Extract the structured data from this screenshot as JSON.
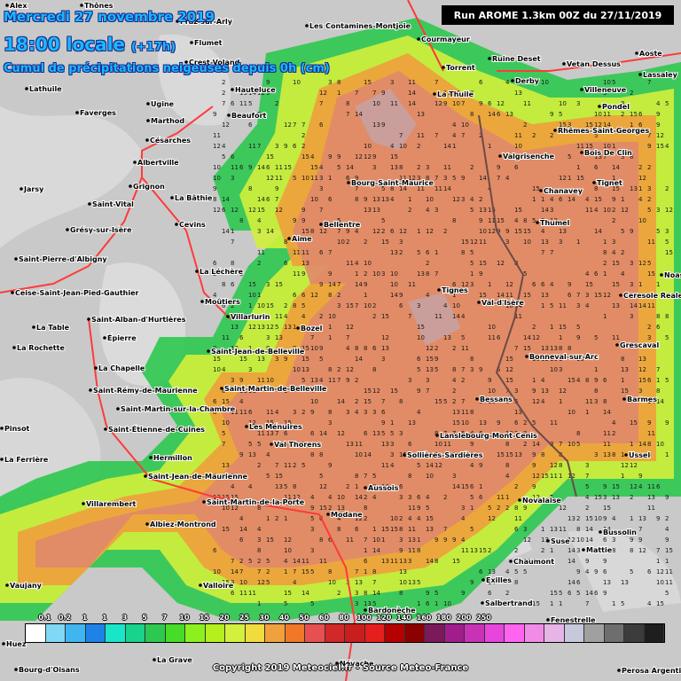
{
  "header": {
    "date": "Mercredi 27 novembre 2019",
    "time": "18:00 locale",
    "offset": "(+17h)",
    "subtitle": "Cumul de précipitations neigeuses depuis 0h (cm)",
    "run": "Run AROME 1.3km 00Z du 27/11/2019"
  },
  "footer": {
    "copyright": "Copyright 2019 Meteociel.fr - Source Meteo-France"
  },
  "legend": {
    "colors": [
      "#ffffff",
      "#7fd8f5",
      "#3fb6f0",
      "#1e82e6",
      "#19e6c8",
      "#19d28c",
      "#2dc850",
      "#46dc28",
      "#8cf01e",
      "#b4f01e",
      "#d2f03c",
      "#f0dc3c",
      "#f0a03c",
      "#f07828",
      "#e65050",
      "#d22828",
      "#c81e1e",
      "#e61e1e",
      "#b40000",
      "#8c0000",
      "#7a1a5a",
      "#a01e8c",
      "#c832b4",
      "#e646dc",
      "#ff64f0",
      "#f08ce6",
      "#e6b4e6",
      "#c8c8dc",
      "#a0a0a0",
      "#6e6e6e",
      "#3c3c3c",
      "#1e1e1e"
    ],
    "labels": [
      "0.1",
      "0.2",
      "1",
      "1",
      "3",
      "5",
      "7",
      "10",
      "15",
      "20",
      "25",
      "30",
      "40",
      "50",
      "60",
      "80",
      "100",
      "120",
      "140",
      "160",
      "180",
      "200",
      "250"
    ]
  },
  "places": [
    {
      "name": "Alex"
    },
    {
      "name": "Thônes"
    },
    {
      "name": "Praz-sur-Arly"
    },
    {
      "name": "Les Contamines-Montjoie"
    },
    {
      "name": "Courmayeur"
    },
    {
      "name": "Flumet"
    },
    {
      "name": "Crest-Voland"
    },
    {
      "name": "Torrent"
    },
    {
      "name": "Ruine Deset"
    },
    {
      "name": "Aoste"
    },
    {
      "name": "Vetan Dessus"
    },
    {
      "name": "Lassaley"
    },
    {
      "name": "Derby"
    },
    {
      "name": "Villeneuve"
    },
    {
      "name": "Lathuile"
    },
    {
      "name": "Ugine"
    },
    {
      "name": "Hauteluce"
    },
    {
      "name": "La Thuile"
    },
    {
      "name": "Faverges"
    },
    {
      "name": "Pondel"
    },
    {
      "name": "Marthod"
    },
    {
      "name": "Beaufort"
    },
    {
      "name": "Rhêmes-Saint-Georges"
    },
    {
      "name": "Césarches"
    },
    {
      "name": "Valgrisenche"
    },
    {
      "name": "Bois De Clin"
    },
    {
      "name": "Albertville"
    },
    {
      "name": "Grignon"
    },
    {
      "name": "Bourg-Saint-Maurice"
    },
    {
      "name": "Tignet"
    },
    {
      "name": "Jarsy"
    },
    {
      "name": "Chanavey"
    },
    {
      "name": "La Bâthie"
    },
    {
      "name": "Saint-Vital"
    },
    {
      "name": "Thumel"
    },
    {
      "name": "Cevins"
    },
    {
      "name": "Bellentre"
    },
    {
      "name": "Grésy-sur-Isère"
    },
    {
      "name": "Aime"
    },
    {
      "name": "Saint-Pierre-d'Albigny"
    },
    {
      "name": "La Léchère"
    },
    {
      "name": "Tignes"
    },
    {
      "name": "Noasca"
    },
    {
      "name": "Ceise-Saint-Jean-Pied-Gauthier"
    },
    {
      "name": "Moûtiers"
    },
    {
      "name": "Val-d'Isère"
    },
    {
      "name": "Ceresole Reale"
    },
    {
      "name": "Villarlurin"
    },
    {
      "name": "Saint-Alban-d'Hurtières"
    },
    {
      "name": "La Table"
    },
    {
      "name": "Bozel"
    },
    {
      "name": "Grescaval"
    },
    {
      "name": "Épierre"
    },
    {
      "name": "La Rochette"
    },
    {
      "name": "Saint-Jean-de-Belleville"
    },
    {
      "name": "Bonneval-sur-Arc"
    },
    {
      "name": "La Chapelle"
    },
    {
      "name": "Saint-Martin-de-Belleville"
    },
    {
      "name": "Saint-Rémy-de-Maurienne"
    },
    {
      "name": "Bessans"
    },
    {
      "name": "Barmes"
    },
    {
      "name": "Saint-Martin-sur-la-Chambre"
    },
    {
      "name": "Les Ménuires"
    },
    {
      "name": "Lanslebourg-Mont-Cenis"
    },
    {
      "name": "Pinsot"
    },
    {
      "name": "Saint-Étienne-de-Cuines"
    },
    {
      "name": "Val Thorens"
    },
    {
      "name": "La Ferrière"
    },
    {
      "name": "Sollières-Sardières"
    },
    {
      "name": "Hermillon"
    },
    {
      "name": "Ussel"
    },
    {
      "name": "Saint-Jean-de-Maurienne"
    },
    {
      "name": "Aussois"
    },
    {
      "name": "Novalaise"
    },
    {
      "name": "Saint-Martin-de-la-Porte"
    },
    {
      "name": "Villarembert"
    },
    {
      "name": "Modane"
    },
    {
      "name": "Albiez-Montrond"
    },
    {
      "name": "Suse"
    },
    {
      "name": "Bussolin"
    },
    {
      "name": "Valloire"
    },
    {
      "name": "Mattie"
    },
    {
      "name": "Chaumont"
    },
    {
      "name": "Exilles"
    },
    {
      "name": "Vaujany"
    },
    {
      "name": "Salbertrand"
    },
    {
      "name": "Bardonèche"
    },
    {
      "name": "Fenestrelle"
    },
    {
      "name": "Huez"
    },
    {
      "name": "Bourg-d'Oisans"
    },
    {
      "name": "La Grave"
    },
    {
      "name": "Névache"
    },
    {
      "name": "Perosa Argentina"
    }
  ]
}
